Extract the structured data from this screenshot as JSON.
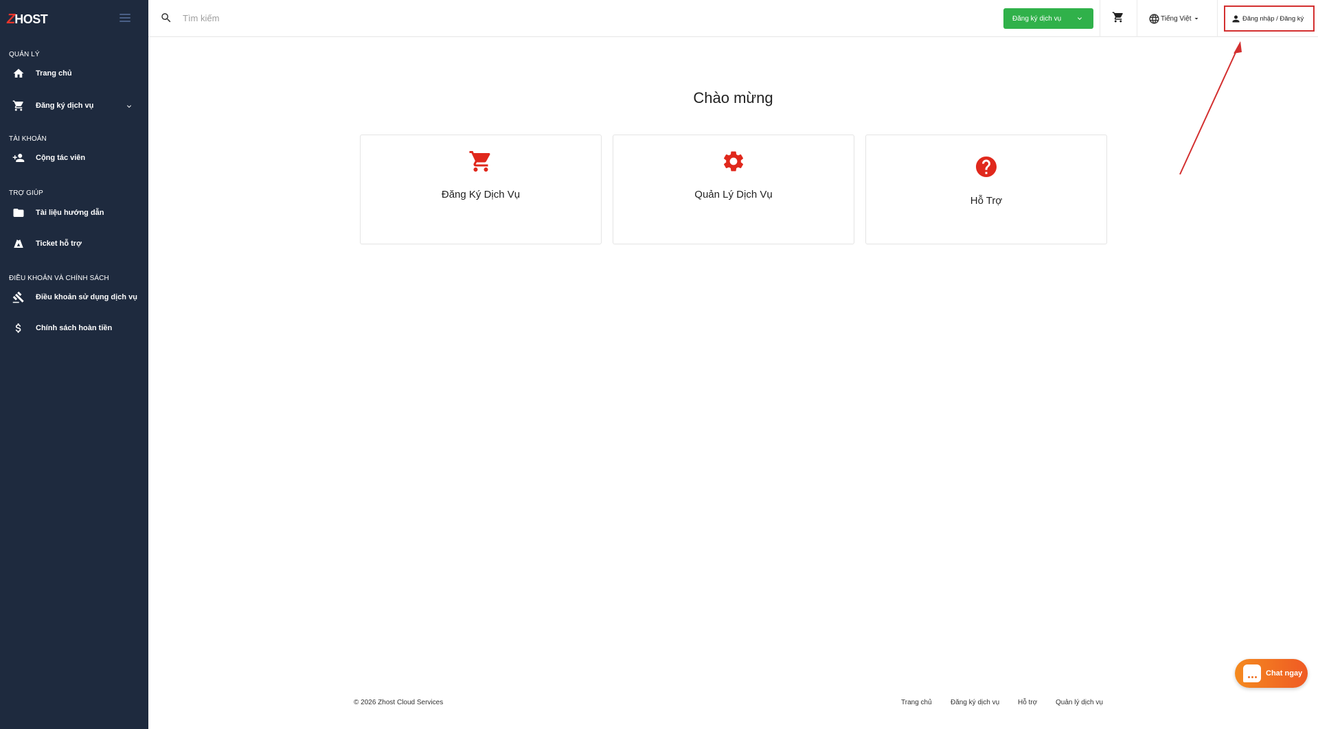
{
  "sidebar": {
    "brand_z": "Z",
    "brand_host": "HOST",
    "sections": [
      {
        "title": "QUẢN LÝ"
      },
      {
        "title": "TÀI KHOẢN"
      },
      {
        "title": "TRỢ GIÚP"
      },
      {
        "title": "ĐIỀU KHOẢN VÀ CHÍNH SÁCH"
      }
    ],
    "items": [
      {
        "label": "Trang chủ",
        "icon": "home-icon"
      },
      {
        "label": "Đăng ký dịch vụ",
        "icon": "cart-icon"
      },
      {
        "label": "Cộng tác viên",
        "icon": "user-add-icon"
      },
      {
        "label": "Tài liệu hướng dẫn",
        "icon": "folder-icon"
      },
      {
        "label": "Ticket hỗ trợ",
        "icon": "ticket-icon"
      },
      {
        "label": "Điều khoản sử dụng dịch vụ",
        "icon": "gavel-icon"
      },
      {
        "label": "Chính sách hoàn tiền",
        "icon": "dollar-icon"
      }
    ]
  },
  "topbar": {
    "search_placeholder": "Tìm kiếm",
    "register_label": "Đăng ký dịch vụ",
    "language_label": "Tiếng Việt",
    "login_label": "Đăng nhập / Đăng ký"
  },
  "main": {
    "welcome": "Chào mừng",
    "cards": [
      {
        "label": "Đăng Ký Dịch Vụ",
        "icon": "cart-icon"
      },
      {
        "label": "Quản Lý Dịch Vụ",
        "icon": "gear-icon"
      },
      {
        "label": "Hỗ Trợ",
        "icon": "help-icon"
      }
    ]
  },
  "footer": {
    "copyright": "© 2026 Zhost Cloud Services",
    "links": [
      "Trang chủ",
      "Đăng ký dịch vụ",
      "Hỗ trợ",
      "Quản lý dịch vụ"
    ]
  },
  "chat": {
    "label": "Chat ngay"
  },
  "colors": {
    "sidebar_bg": "#1e2a3e",
    "accent_red": "#e0281c",
    "register_green": "#30b14a",
    "chat_orange": "#f07526",
    "annotation_red": "#d32f2f"
  }
}
